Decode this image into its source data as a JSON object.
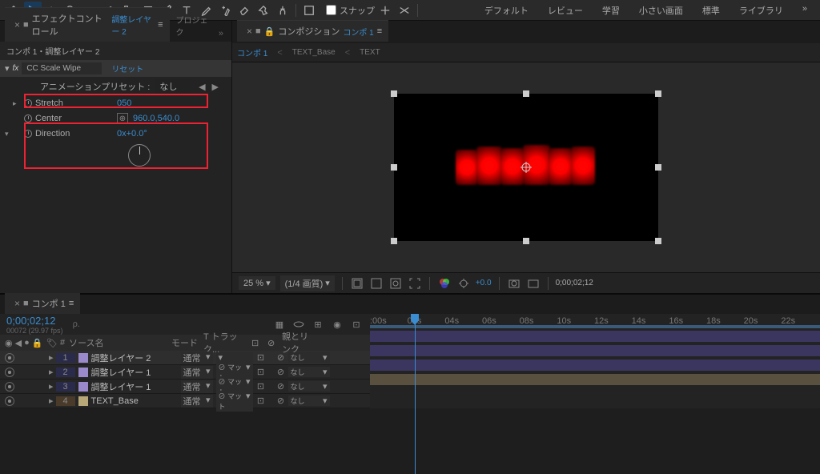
{
  "toolbar": {
    "snap_label": "スナップ",
    "workspaces": [
      "デフォルト",
      "レビュー",
      "学習",
      "小さい画面",
      "標準",
      "ライブラリ"
    ]
  },
  "effect_panel": {
    "tab_title": "エフェクトコントロール",
    "layer_link": "調整レイヤー 2",
    "project_tab": "プロジェク",
    "comp_path": "コンポ 1・調整レイヤー 2",
    "effect_name": "CC Scale Wipe",
    "reset_label": "リセット",
    "preset_label": "アニメーションプリセット :",
    "preset_value": "なし",
    "stretch_label": "Stretch",
    "stretch_value": "050",
    "center_label": "Center",
    "center_value": "960.0,540.0",
    "direction_label": "Direction",
    "direction_value": "0x+0.0°"
  },
  "viewer": {
    "tab_prefix": "コンポジション",
    "comp_name": "コンポ 1",
    "sub_tabs": [
      "コンポ 1",
      "TEXT_Base",
      "TEXT"
    ],
    "zoom": "25 %",
    "resolution": "(1/4 画質)",
    "exposure": "+0.0",
    "timecode": "0;00;02;12"
  },
  "timeline": {
    "tab": "コンポ 1",
    "current_time": "0;00;02;12",
    "frame_info": "00072 (29.97 fps)",
    "search_placeholder": "ρ.",
    "col_source": "ソース名",
    "col_mode": "モード",
    "col_track": "T トラック...",
    "col_parent": "親とリンク",
    "none_label": "なし",
    "mode_normal": "通常",
    "matte_label": "マット",
    "layers": [
      {
        "index": "1",
        "name": "調整レイヤー 2",
        "color": "purple"
      },
      {
        "index": "2",
        "name": "調整レイヤー 1",
        "color": "purple"
      },
      {
        "index": "3",
        "name": "調整レイヤー 1",
        "color": "purple"
      },
      {
        "index": "4",
        "name": "TEXT_Base",
        "color": "tan"
      }
    ],
    "ruler_ticks": [
      ":00s",
      "02s",
      "04s",
      "06s",
      "08s",
      "10s",
      "12s",
      "14s",
      "16s",
      "18s",
      "20s",
      "22s"
    ]
  }
}
